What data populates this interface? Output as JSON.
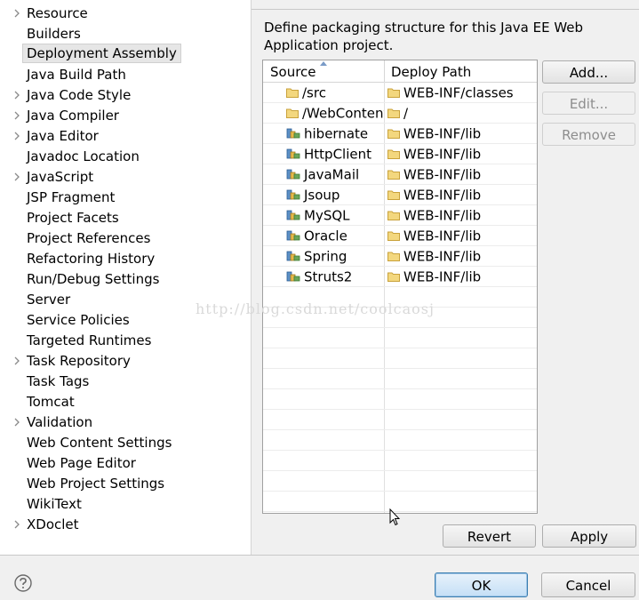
{
  "sidebar": {
    "items": [
      {
        "label": "Resource",
        "expandable": true,
        "selected": false
      },
      {
        "label": "Builders",
        "expandable": false,
        "selected": false
      },
      {
        "label": "Deployment Assembly",
        "expandable": false,
        "selected": true
      },
      {
        "label": "Java Build Path",
        "expandable": false,
        "selected": false
      },
      {
        "label": "Java Code Style",
        "expandable": true,
        "selected": false
      },
      {
        "label": "Java Compiler",
        "expandable": true,
        "selected": false
      },
      {
        "label": "Java Editor",
        "expandable": true,
        "selected": false
      },
      {
        "label": "Javadoc Location",
        "expandable": false,
        "selected": false
      },
      {
        "label": "JavaScript",
        "expandable": true,
        "selected": false
      },
      {
        "label": "JSP Fragment",
        "expandable": false,
        "selected": false
      },
      {
        "label": "Project Facets",
        "expandable": false,
        "selected": false
      },
      {
        "label": "Project References",
        "expandable": false,
        "selected": false
      },
      {
        "label": "Refactoring History",
        "expandable": false,
        "selected": false
      },
      {
        "label": "Run/Debug Settings",
        "expandable": false,
        "selected": false
      },
      {
        "label": "Server",
        "expandable": false,
        "selected": false
      },
      {
        "label": "Service Policies",
        "expandable": false,
        "selected": false
      },
      {
        "label": "Targeted Runtimes",
        "expandable": false,
        "selected": false
      },
      {
        "label": "Task Repository",
        "expandable": true,
        "selected": false
      },
      {
        "label": "Task Tags",
        "expandable": false,
        "selected": false
      },
      {
        "label": "Tomcat",
        "expandable": false,
        "selected": false
      },
      {
        "label": "Validation",
        "expandable": true,
        "selected": false
      },
      {
        "label": "Web Content Settings",
        "expandable": false,
        "selected": false
      },
      {
        "label": "Web Page Editor",
        "expandable": false,
        "selected": false
      },
      {
        "label": "Web Project Settings",
        "expandable": false,
        "selected": false
      },
      {
        "label": "WikiText",
        "expandable": false,
        "selected": false
      },
      {
        "label": "XDoclet",
        "expandable": true,
        "selected": false
      }
    ]
  },
  "main": {
    "description": "Define packaging structure for this Java EE Web Application project.",
    "table": {
      "headers": {
        "source": "Source",
        "deploy": "Deploy Path"
      },
      "rows": [
        {
          "source": "/src",
          "deploy": "WEB-INF/classes",
          "source_icon": "folder-icon"
        },
        {
          "source": "/WebContent",
          "deploy": "/",
          "source_icon": "folder-icon"
        },
        {
          "source": "hibernate",
          "deploy": "WEB-INF/lib",
          "source_icon": "library-icon"
        },
        {
          "source": "HttpClient",
          "deploy": "WEB-INF/lib",
          "source_icon": "library-icon"
        },
        {
          "source": "JavaMail",
          "deploy": "WEB-INF/lib",
          "source_icon": "library-icon"
        },
        {
          "source": "Jsoup",
          "deploy": "WEB-INF/lib",
          "source_icon": "library-icon"
        },
        {
          "source": "MySQL",
          "deploy": "WEB-INF/lib",
          "source_icon": "library-icon"
        },
        {
          "source": "Oracle",
          "deploy": "WEB-INF/lib",
          "source_icon": "library-icon"
        },
        {
          "source": "Spring",
          "deploy": "WEB-INF/lib",
          "source_icon": "library-icon"
        },
        {
          "source": "Struts2",
          "deploy": "WEB-INF/lib",
          "source_icon": "library-icon"
        }
      ]
    },
    "buttons": {
      "add": "Add...",
      "edit": "Edit...",
      "remove": "Remove",
      "revert": "Revert",
      "apply": "Apply"
    }
  },
  "footer": {
    "ok": "OK",
    "cancel": "Cancel"
  },
  "watermark": "http://blog.csdn.net/coolcaosj",
  "colors": {
    "folder": "#e8c35a",
    "library": "#4a7fb5",
    "default_button_border": "#3c7fb1"
  }
}
